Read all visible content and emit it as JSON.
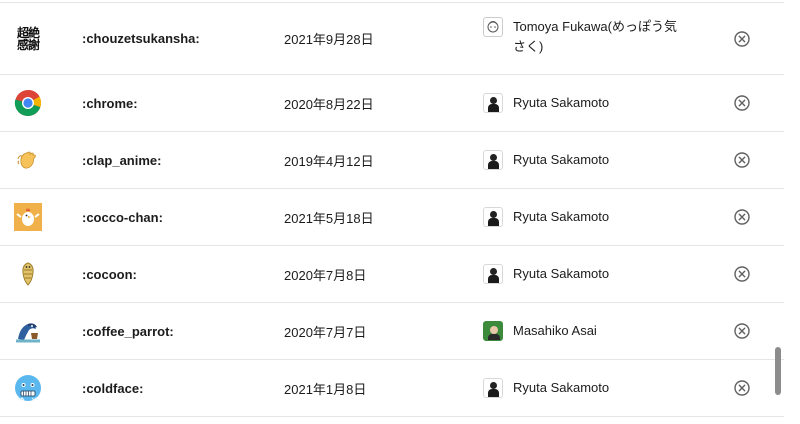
{
  "rows": [
    {
      "name": ":chouzetsukansha:",
      "date": "2021年9月28日",
      "user": "Tomoya Fukawa(めっぽう気さく)",
      "avatar": "tomoya",
      "emoji_icon": "chouzetsukansha-emoji-icon",
      "emoji_text": "超絶感謝"
    },
    {
      "name": ":chrome:",
      "date": "2020年8月22日",
      "user": "Ryuta Sakamoto",
      "avatar": "ryuta",
      "emoji_icon": "chrome-logo-icon"
    },
    {
      "name": ":clap_anime:",
      "date": "2019年4月12日",
      "user": "Ryuta Sakamoto",
      "avatar": "ryuta",
      "emoji_icon": "clapping-hands-icon"
    },
    {
      "name": ":cocco-chan:",
      "date": "2021年5月18日",
      "user": "Ryuta Sakamoto",
      "avatar": "ryuta",
      "emoji_icon": "chicken-icon"
    },
    {
      "name": ":cocoon:",
      "date": "2020年7月8日",
      "user": "Ryuta Sakamoto",
      "avatar": "ryuta",
      "emoji_icon": "cocoon-icon"
    },
    {
      "name": ":coffee_parrot:",
      "date": "2020年7月7日",
      "user": "Masahiko Asai",
      "avatar": "masahiko",
      "emoji_icon": "parrot-icon"
    },
    {
      "name": ":coldface:",
      "date": "2021年1月8日",
      "user": "Ryuta Sakamoto",
      "avatar": "ryuta",
      "emoji_icon": "cold-face-icon"
    }
  ],
  "remove_icon": "circle-x-icon",
  "colors": {
    "border": "#e6e6e6",
    "text": "#1d1c1d",
    "icon": "#616061",
    "scrollbar": "#8c8c8c"
  }
}
